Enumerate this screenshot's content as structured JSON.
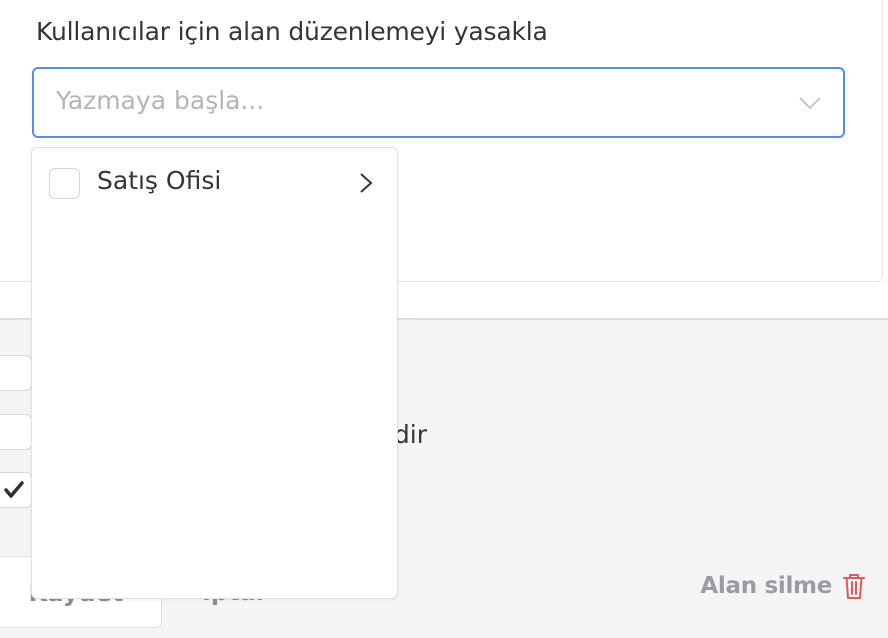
{
  "field": {
    "label": "Kullanıcılar için alan düzenlemeyi yasakla",
    "placeholder": "Yazmaya başla..."
  },
  "dropdown": {
    "items": [
      {
        "label": "Satış Ofisi",
        "checked": false,
        "has_children": true
      }
    ]
  },
  "options": {
    "visible_text_fragment": "lidir"
  },
  "footer": {
    "save_label": "Kaydet",
    "cancel_label": "İptal",
    "delete_label": "Alan silme"
  },
  "colors": {
    "focus_border": "#5b8be5",
    "delete_icon": "#e05a5a",
    "panel_bg": "#f5f5f6"
  },
  "icons": {
    "select_chevron": "chevron-down-icon",
    "item_arrow": "chevron-right-icon",
    "delete": "trash-icon",
    "checked": "checkmark-icon"
  }
}
